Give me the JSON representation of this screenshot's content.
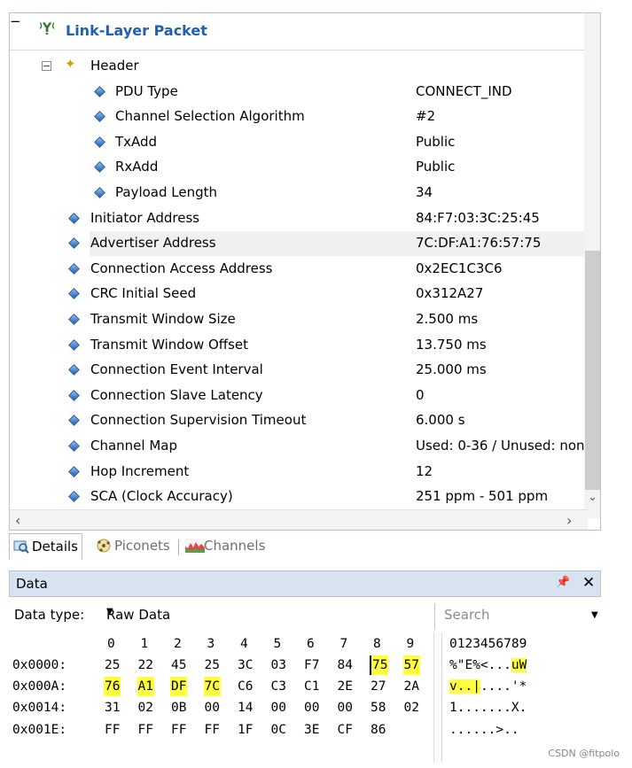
{
  "tree": {
    "root_label": "Link-Layer Packet",
    "header_label": "Header",
    "header_fields": [
      {
        "label": "PDU Type",
        "value": "CONNECT_IND"
      },
      {
        "label": "Channel Selection Algorithm",
        "value": "#2"
      },
      {
        "label": "TxAdd",
        "value": "Public"
      },
      {
        "label": "RxAdd",
        "value": "Public"
      },
      {
        "label": "Payload Length",
        "value": "34"
      }
    ],
    "fields": [
      {
        "label": "Initiator Address",
        "value": "84:F7:03:3C:25:45"
      },
      {
        "label": "Advertiser Address",
        "value": "7C:DF:A1:76:57:75"
      },
      {
        "label": "Connection Access Address",
        "value": "0x2EC1C3C6"
      },
      {
        "label": "CRC Initial Seed",
        "value": "0x312A27"
      },
      {
        "label": "Transmit Window Size",
        "value": "2.500 ms"
      },
      {
        "label": "Transmit Window Offset",
        "value": "13.750 ms"
      },
      {
        "label": "Connection Event Interval",
        "value": "25.000 ms"
      },
      {
        "label": "Connection Slave Latency",
        "value": "0"
      },
      {
        "label": "Connection Supervision Timeout",
        "value": "6.000 s"
      },
      {
        "label": "Channel Map",
        "value": "Used: 0-36 / Unused: non"
      },
      {
        "label": "Hop Increment",
        "value": "12"
      },
      {
        "label": "SCA (Clock Accuracy)",
        "value": "251 ppm - 501 ppm"
      }
    ],
    "collapse_symbol": "⊟"
  },
  "tabs": [
    {
      "label": "Details",
      "icon": "magnifier-icon"
    },
    {
      "label": "Piconets",
      "icon": "piconet-icon"
    },
    {
      "label": "Channels",
      "icon": "channels-chart-icon"
    }
  ],
  "data_panel": {
    "title": "Data",
    "pin_symbol": "📌",
    "close_symbol": "✕",
    "data_type_label": "Data type:",
    "data_type_value": "Raw Data",
    "search_placeholder": "Search",
    "column_headers": [
      "0",
      "1",
      "2",
      "3",
      "4",
      "5",
      "6",
      "7",
      "8",
      "9"
    ],
    "ascii_header": "0123456789",
    "rows": [
      {
        "offset": "0x0000:",
        "bytes": [
          "25",
          "22",
          "45",
          "25",
          "3C",
          "03",
          "F7",
          "84",
          "75",
          "57"
        ],
        "ascii": "%\"E%<...uW"
      },
      {
        "offset": "0x000A:",
        "bytes": [
          "76",
          "A1",
          "DF",
          "7C",
          "C6",
          "C3",
          "C1",
          "2E",
          "27",
          "2A"
        ],
        "ascii": "v..|....'*"
      },
      {
        "offset": "0x0014:",
        "bytes": [
          "31",
          "02",
          "0B",
          "00",
          "14",
          "00",
          "00",
          "00",
          "58",
          "02"
        ],
        "ascii": "1.......X."
      },
      {
        "offset": "0x001E:",
        "bytes": [
          "FF",
          "FF",
          "FF",
          "FF",
          "1F",
          "0C",
          "3E",
          "CF",
          "86"
        ],
        "ascii": "......>.."
      }
    ]
  },
  "colors": {
    "highlight": "#ffff3c",
    "root_title": "#1e5fb4",
    "panel_header": "#d7e3f1"
  },
  "watermark": "CSDN @fitpolo"
}
